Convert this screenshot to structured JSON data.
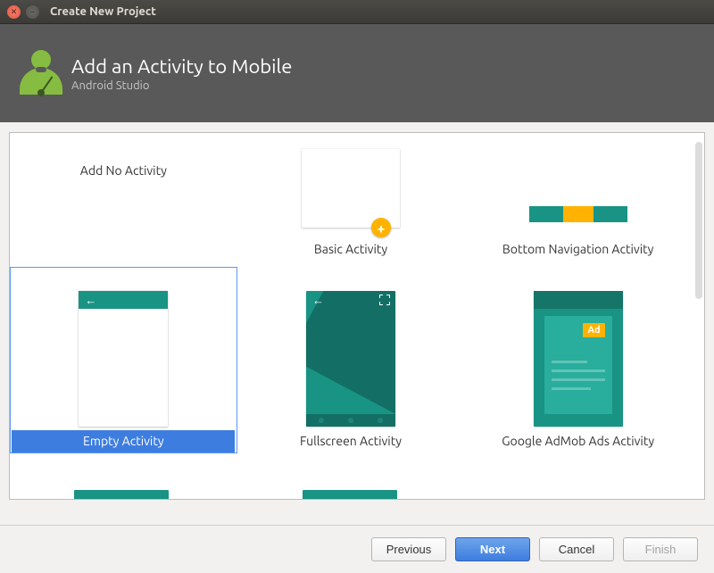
{
  "window": {
    "title": "Create New Project"
  },
  "header": {
    "title": "Add an Activity to Mobile",
    "subtitle": "Android Studio"
  },
  "activities": {
    "addNo": {
      "label": "Add No Activity"
    },
    "basic": {
      "label": "Basic Activity"
    },
    "bottomNav": {
      "label": "Bottom Navigation Activity"
    },
    "empty": {
      "label": "Empty Activity"
    },
    "fullscreen": {
      "label": "Fullscreen Activity"
    },
    "admob": {
      "label": "Google AdMob Ads Activity",
      "badge": "Ad"
    }
  },
  "selected": "empty",
  "buttons": {
    "previous": "Previous",
    "next": "Next",
    "cancel": "Cancel",
    "finish": "Finish"
  }
}
